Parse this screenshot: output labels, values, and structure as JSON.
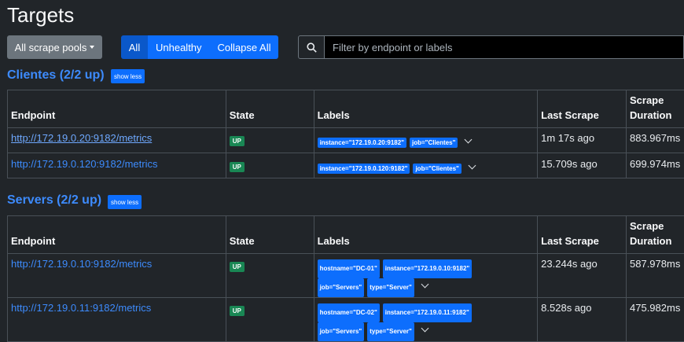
{
  "page_title": "Targets",
  "toolbar": {
    "pools_label": "All scrape pools",
    "filter_all": "All",
    "filter_unhealthy": "Unhealthy",
    "collapse_all": "Collapse All",
    "search_placeholder": "Filter by endpoint or labels"
  },
  "columns": {
    "endpoint": "Endpoint",
    "state": "State",
    "labels": "Labels",
    "last_scrape": "Last Scrape",
    "duration_line1": "Scrape",
    "duration_line2": "Duration"
  },
  "pools": [
    {
      "title": "Clientes (2/2 up)",
      "toggle": "show less",
      "targets": [
        {
          "endpoint": "http://172.19.0.20:9182/metrics",
          "state": "UP",
          "labels": [
            "instance=\"172.19.0.20:9182\"",
            "job=\"Clientes\""
          ],
          "last_scrape": "1m 17s ago",
          "duration": "883.967ms"
        },
        {
          "endpoint": "http://172.19.0.120:9182/metrics",
          "state": "UP",
          "labels": [
            "instance=\"172.19.0.120:9182\"",
            "job=\"Clientes\""
          ],
          "last_scrape": "15.709s ago",
          "duration": "699.974ms"
        }
      ]
    },
    {
      "title": "Servers (2/2 up)",
      "toggle": "show less",
      "targets": [
        {
          "endpoint": "http://172.19.0.10:9182/metrics",
          "state": "UP",
          "labels": [
            "hostname=\"DC-01\"",
            "instance=\"172.19.0.10:9182\"",
            "job=\"Servers\"",
            "type=\"Server\""
          ],
          "last_scrape": "23.244s ago",
          "duration": "587.978ms"
        },
        {
          "endpoint": "http://172.19.0.11:9182/metrics",
          "state": "UP",
          "labels": [
            "hostname=\"DC-02\"",
            "instance=\"172.19.0.11:9182\"",
            "job=\"Servers\"",
            "type=\"Server\""
          ],
          "last_scrape": "8.528s ago",
          "duration": "475.982ms"
        }
      ]
    }
  ]
}
